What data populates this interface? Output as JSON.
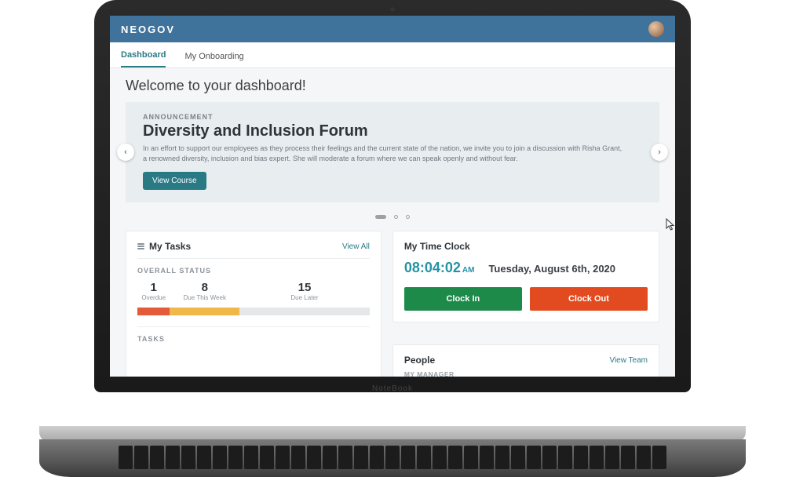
{
  "brand": "NEOGOV",
  "tabs": {
    "dashboard": "Dashboard",
    "onboarding": "My Onboarding"
  },
  "welcome": "Welcome to your dashboard!",
  "announcement": {
    "label": "ANNOUNCEMENT",
    "title": "Diversity and Inclusion Forum",
    "body": "In an effort to support our employees as they process their feelings and the current state of the nation, we invite you to join a discussion with Risha Grant, a renowned diversity, inclusion and bias expert. She will moderate a forum where we can speak openly and without fear.",
    "button": "View Course"
  },
  "tasks": {
    "title": "My Tasks",
    "link": "View All",
    "overall_label": "OVERALL STATUS",
    "stats": {
      "overdue_n": "1",
      "overdue_l": "Overdue",
      "week_n": "8",
      "week_l": "Due This Week",
      "later_n": "15",
      "later_l": "Due Later"
    },
    "tasks_label": "TASKS"
  },
  "timeclock": {
    "title": "My Time Clock",
    "time": "08:04:02",
    "ampm": "AM",
    "date": "Tuesday, August 6th, 2020",
    "clock_in": "Clock In",
    "clock_out": "Clock Out"
  },
  "people": {
    "title": "People",
    "link": "View Team",
    "manager_label": "MY MANAGER"
  },
  "laptop_label": "NoteBook"
}
